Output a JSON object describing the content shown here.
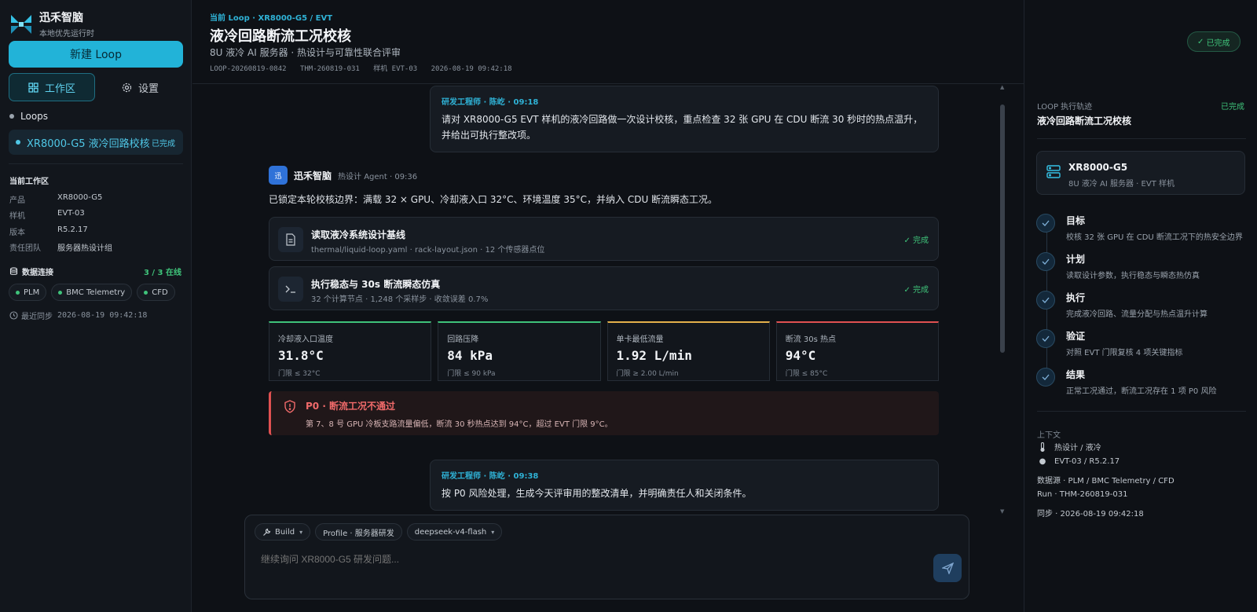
{
  "brand": {
    "name": "迅禾智脑",
    "subtitle": "本地优先运行时",
    "avatar_char": "迅"
  },
  "sidebar": {
    "new_button": "新建 Loop",
    "tabs": [
      {
        "label": "工作区",
        "active": true
      },
      {
        "label": "设置",
        "active": false
      }
    ],
    "loops_title": "Loops",
    "loops": [
      {
        "name": "XR8000-G5 液冷回路校核",
        "status": "已完成"
      }
    ],
    "workspace_title": "当前工作区",
    "workspace": [
      {
        "key": "产品",
        "value": "XR8000-G5"
      },
      {
        "key": "样机",
        "value": "EVT-03"
      },
      {
        "key": "版本",
        "value": "R5.2.17"
      },
      {
        "key": "责任团队",
        "value": "服务器热设计组"
      }
    ],
    "connections_title": "数据连接",
    "connections_count": "3 / 3 在线",
    "connections": [
      "PLM",
      "BMC Telemetry",
      "CFD"
    ],
    "last_sync": "最近同步",
    "last_sync_time": "2026-08-19 09:42:18"
  },
  "header": {
    "breadcrumb": "当前 Loop · XR8000-G5 / EVT",
    "title": "液冷回路断流工况校核",
    "subtitle": "8U 液冷 AI 服务器 · 热设计与可靠性联合评审",
    "meta": [
      "LOOP-20260819-0842",
      "THM-260819-031",
      "样机 EVT-03",
      "2026-08-19 09:42:18"
    ],
    "status": "已完成"
  },
  "chat": {
    "user1": {
      "who": "研发工程师 · 陈屹 · 09:18",
      "text": "请对 XR8000-G5 EVT 样机的液冷回路做一次设计校核，重点检查 32 张 GPU 在 CDU 断流 30 秒时的热点温升，并给出可执行整改项。"
    },
    "agent": {
      "name": "迅禾智脑",
      "meta": "热设计 Agent · 09:36",
      "text": "已锁定本轮校核边界：满载 32 × GPU、冷却液入口 32°C、环境温度 35°C，并纳入 CDU 断流瞬态工况。"
    },
    "tools": [
      {
        "title": "读取液冷系统设计基线",
        "detail": "thermal/liquid-loop.yaml · rack-layout.json · 12 个传感器点位",
        "status": "完成",
        "icon": "file-icon"
      },
      {
        "title": "执行稳态与 30s 断流瞬态仿真",
        "detail": "32 个计算节点 · 1,248 个采样步 · 收敛误差 0.7%",
        "status": "完成",
        "icon": "terminal-icon"
      }
    ],
    "metrics": [
      {
        "label": "冷却液入口温度",
        "value": "31.8°C",
        "threshold": "门限 ≤ 32°C",
        "color": "#3fc37a"
      },
      {
        "label": "回路压降",
        "value": "84 kPa",
        "threshold": "门限 ≤ 90 kPa",
        "color": "#3fc37a"
      },
      {
        "label": "单卡最低流量",
        "value": "1.92 L/min",
        "threshold": "门限 ≥ 2.00 L/min",
        "color": "#e3b04b"
      },
      {
        "label": "断流 30s 热点",
        "value": "94°C",
        "threshold": "门限 ≤ 85°C",
        "color": "#e05151"
      }
    ],
    "alert": {
      "title": "P0 · 断流工况不通过",
      "body": "第 7、8 号 GPU 冷板支路流量偏低，断流 30 秒热点达到 94°C，超过 EVT 门限 9°C。"
    },
    "user2": {
      "who": "研发工程师 · 陈屹 · 09:38",
      "text": "按 P0 风险处理，生成今天评审用的整改清单，并明确责任人和关闭条件。"
    }
  },
  "composer": {
    "mode": "Build",
    "profile": "Profile · 服务器研发",
    "model": "deepseek-v4-flash",
    "placeholder": "继续询问 XR8000-G5 研发问题..."
  },
  "right": {
    "label": "LOOP 执行轨迹",
    "status": "已完成",
    "title": "液冷回路断流工况校核",
    "product": {
      "name": "XR8000-G5",
      "desc": "8U 液冷 AI 服务器 · EVT 样机"
    },
    "steps": [
      {
        "name": "目标",
        "desc": "校核 32 张 GPU 在 CDU 断流工况下的热安全边界"
      },
      {
        "name": "计划",
        "desc": "读取设计参数，执行稳态与瞬态热仿真"
      },
      {
        "name": "执行",
        "desc": "完成液冷回路、流量分配与热点温升计算"
      },
      {
        "name": "验证",
        "desc": "对照 EVT 门限复核 4 项关键指标"
      },
      {
        "name": "结果",
        "desc": "正常工况通过，断流工况存在 1 项 P0 风险"
      }
    ],
    "context_label": "上下文",
    "context": [
      "热设计 / 液冷",
      "EVT-03 / R5.2.17",
      "数据源 · PLM / BMC Telemetry / CFD",
      "Run · THM-260819-031",
      "同步 · 2026-08-19 09:42:18"
    ]
  }
}
